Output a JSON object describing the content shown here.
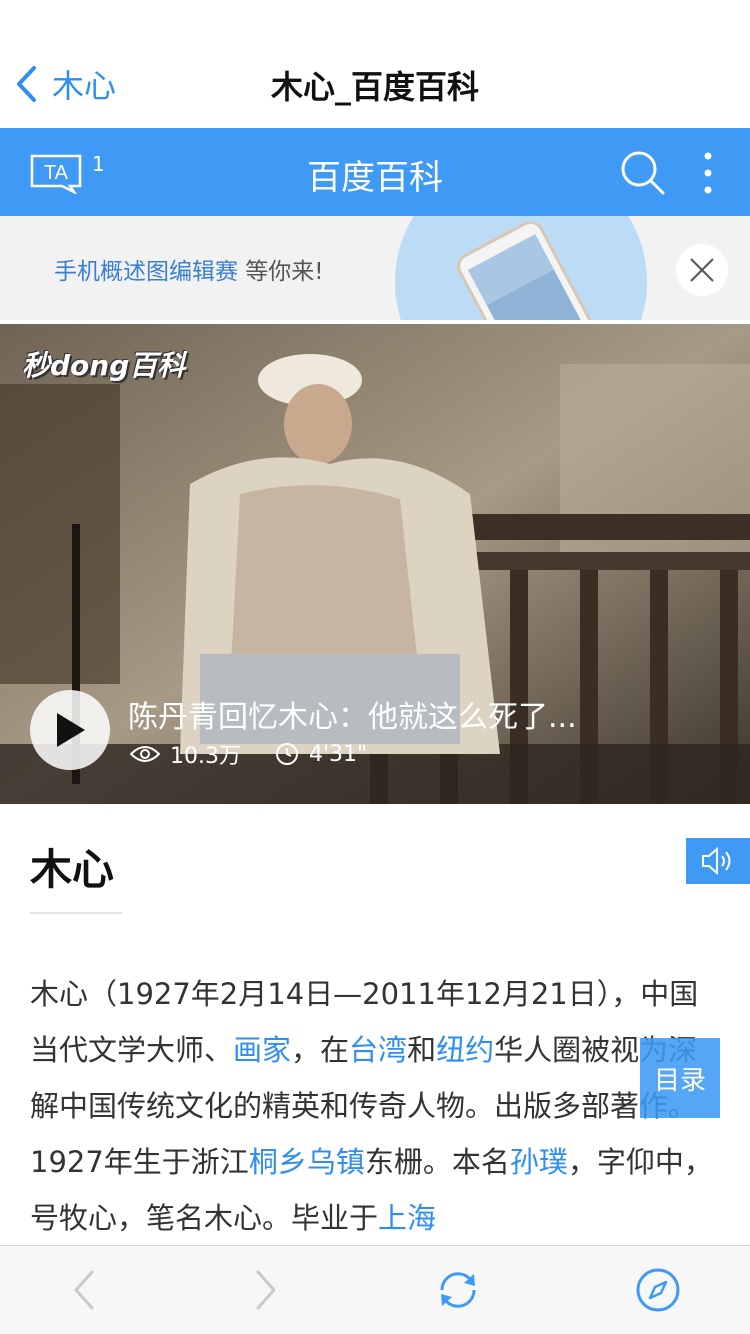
{
  "nav": {
    "back_label": "木心",
    "title": "木心_百度百科"
  },
  "header": {
    "ta_label": "TA",
    "ta_badge": "1",
    "title": "百度百科",
    "accent": "#3e9af4"
  },
  "promo": {
    "link_text": "手机概述图编辑赛",
    "rest_text": " 等你来!"
  },
  "video": {
    "logo": "秒dong百科",
    "title": "陈丹青回忆木心：他就这么死了...",
    "views": "10.3万",
    "duration": "4'31\""
  },
  "article": {
    "title": "木心",
    "body": [
      {
        "text": "木心（1927年2月14日—2011年12月21日），中国当代文学大师、"
      },
      {
        "text": "画家",
        "link": true
      },
      {
        "text": "，在"
      },
      {
        "text": "台湾",
        "link": true
      },
      {
        "text": "和"
      },
      {
        "text": "纽约",
        "link": true
      },
      {
        "text": "华人圈被视为深解中国传统文化的精英和传奇人物。出版多部著作。1927年生于浙江"
      },
      {
        "text": "桐乡乌镇",
        "link": true
      },
      {
        "text": "东栅。本名"
      },
      {
        "text": "孙璞",
        "link": true
      },
      {
        "text": "，字仰中，号牧心，笔名木心。毕业于"
      },
      {
        "text": "上海",
        "link": true
      }
    ],
    "toc_label": "目录"
  },
  "icons": {
    "back": "chevron-left-icon",
    "ta": "ta-chat-icon",
    "search": "search-icon",
    "more": "more-vertical-icon",
    "close": "close-icon",
    "play": "play-icon",
    "views": "eye-icon",
    "duration": "clock-icon",
    "audio": "speaker-icon",
    "toolbar_back": "chevron-left-icon",
    "toolbar_forward": "chevron-right-icon",
    "toolbar_refresh": "refresh-icon",
    "toolbar_compass": "compass-icon"
  }
}
